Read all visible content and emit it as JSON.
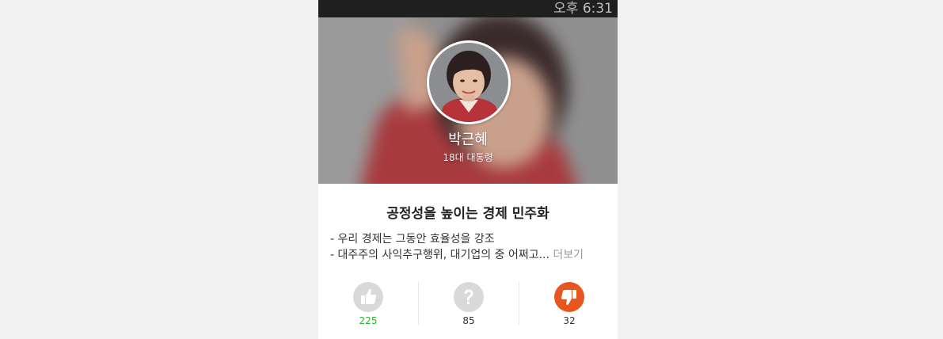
{
  "status_bar": {
    "time": "오후 6:31"
  },
  "profile": {
    "name": "박근혜",
    "title": "18대 대통령"
  },
  "policy": {
    "title": "공정성을 높이는 경제 민주화",
    "lines": [
      "- 우리 경제는 그동안 효율성을 강조",
      "- 대주주의 사익추구행위, 대기업의 중 어쩌고..."
    ],
    "more_label": "더보기"
  },
  "votes": {
    "like": {
      "icon": "thumbs-up-icon",
      "count": "225",
      "color": "#2db32d"
    },
    "question": {
      "icon": "question-icon",
      "count": "85"
    },
    "dislike": {
      "icon": "thumbs-down-icon",
      "count": "32",
      "color": "#e8561f"
    }
  },
  "colors": {
    "status_bar": "#1f1f1f",
    "accent_like": "#2db32d",
    "accent_dislike": "#e8561f",
    "icon_neutral": "#d9d9d9"
  }
}
